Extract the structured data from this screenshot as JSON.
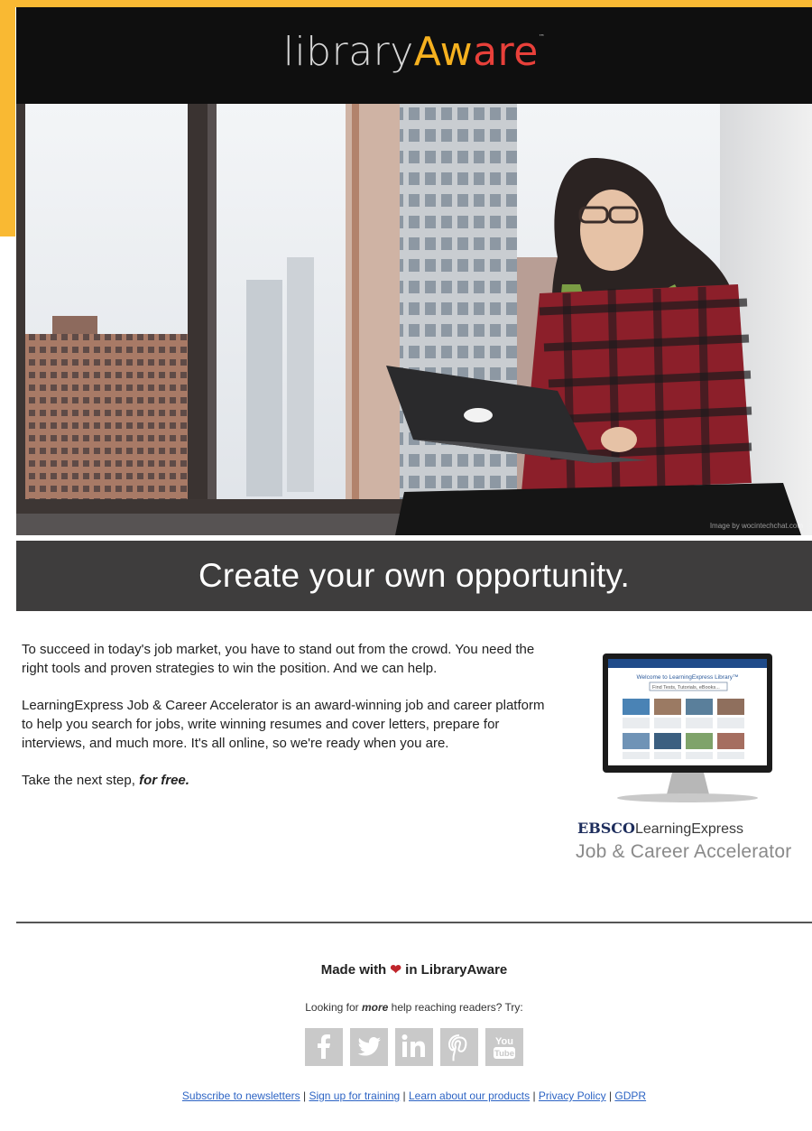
{
  "brand": {
    "logo_part1": "library",
    "logo_part2": "Aw",
    "logo_part3": "are",
    "trademark": "™"
  },
  "hero": {
    "credit": "Image by wocintechchat.com",
    "alt": "Woman with glasses working on a laptop by a window overlooking city buildings"
  },
  "headline": "Create your own opportunity.",
  "body": {
    "p1": "To succeed in today's job market, you have to stand out from the crowd.  You need the right tools and proven strategies to win the position.  And we can help.",
    "p2": "LearningExpress Job & Career Accelerator is an award-winning job and career platform to help you search for jobs, write winning resumes and cover letters, prepare for interviews, and much more. It's all online, so we're ready when you are.",
    "p3_prefix": "Take the next step, ",
    "p3_emphasis": "for free."
  },
  "product": {
    "ebsco": "EBSCO",
    "learningexpress": "LearningExpress",
    "name": "Job & Career Accelerator",
    "screen_title": "Welcome to LearningExpress Library™",
    "screen_search_placeholder": "Find Tests, Tutorials, eBooks..."
  },
  "footer": {
    "made_prefix": "Made with",
    "made_suffix": "in LibraryAware",
    "looking_prefix": "Looking for ",
    "looking_emphasis": "more",
    "looking_suffix": " help reaching readers? Try:",
    "social": [
      {
        "name": "facebook-icon",
        "glyph": "f"
      },
      {
        "name": "twitter-icon",
        "glyph": "t"
      },
      {
        "name": "linkedin-icon",
        "glyph": "in"
      },
      {
        "name": "pinterest-icon",
        "glyph": "p"
      },
      {
        "name": "youtube-icon",
        "glyph": "You Tube"
      }
    ],
    "links": [
      "Subscribe to newsletters",
      "Sign up for training",
      "Learn about our products",
      "Privacy Policy",
      "GDPR"
    ],
    "separator": "|"
  },
  "colors": {
    "accent_orange": "#f9b933",
    "logo_yellow": "#f6b11f",
    "logo_red": "#e8403a",
    "header_bg": "#0f0f0f",
    "headline_bg": "#3e3d3d",
    "link": "#2d64c4",
    "heart": "#c0262c"
  }
}
